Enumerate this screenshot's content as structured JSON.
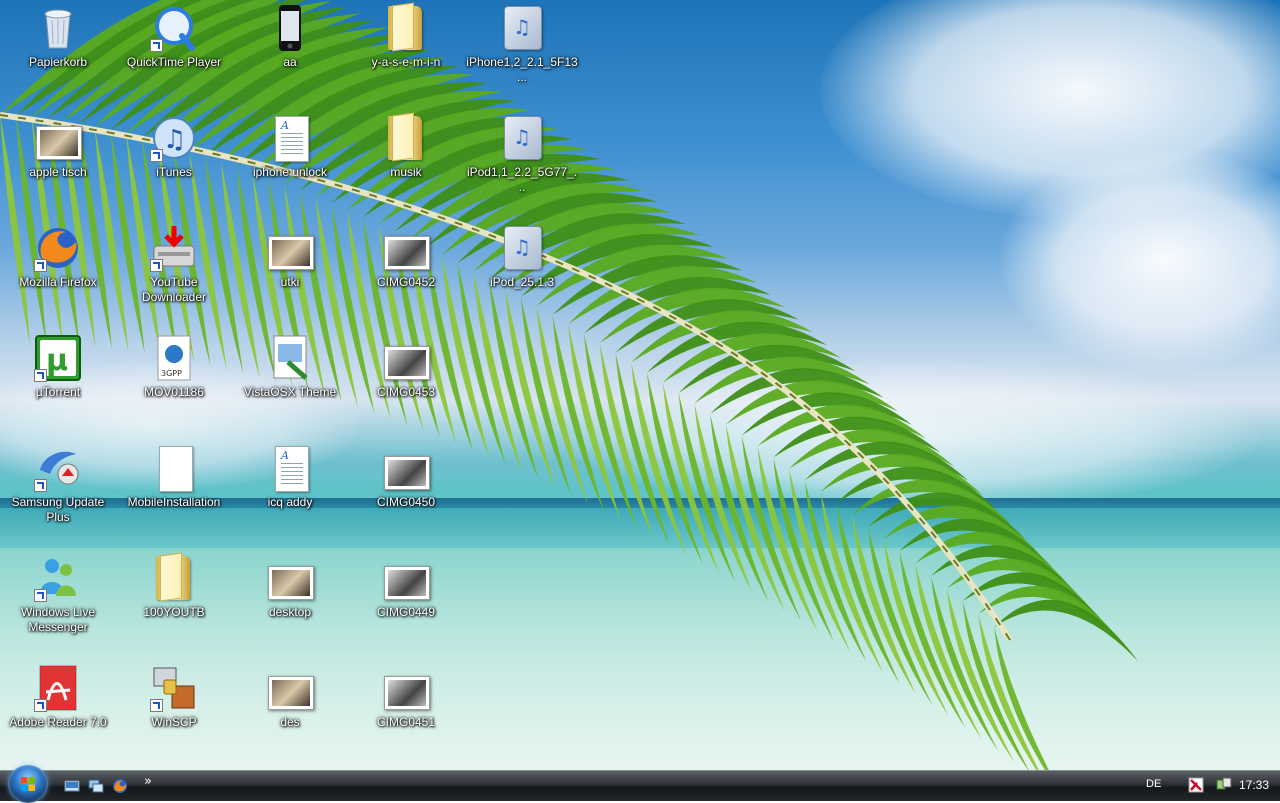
{
  "desktop": {
    "icons": [
      {
        "label": "Papierkorb",
        "icon": "recycle-bin-icon"
      },
      {
        "label": "QuickTime Player",
        "icon": "quicktime-icon"
      },
      {
        "label": "aa",
        "icon": "iphone-icon"
      },
      {
        "label": "y-a-s-e-m-i-n",
        "icon": "folder-icon"
      },
      {
        "label": "iPhone1,2_2.1_5F13...",
        "icon": "ipsw-file-icon"
      },
      {
        "label": "apple tisch",
        "icon": "image-file-icon"
      },
      {
        "label": "iTunes",
        "icon": "itunes-icon"
      },
      {
        "label": "iphone unlock",
        "icon": "text-document-icon"
      },
      {
        "label": "musik",
        "icon": "folder-icon"
      },
      {
        "label": "iPod1,1_2.2_5G77_...",
        "icon": "ipsw-file-icon"
      },
      {
        "label": "Mozilla Firefox",
        "icon": "firefox-icon"
      },
      {
        "label": "YouTube Downloader",
        "icon": "youtube-downloader-icon"
      },
      {
        "label": "utki",
        "icon": "image-file-icon"
      },
      {
        "label": "CIMG0452",
        "icon": "photo-icon"
      },
      {
        "label": "iPod_25.1.3",
        "icon": "ipsw-file-icon"
      },
      {
        "label": "µTorrent",
        "icon": "utorrent-icon"
      },
      {
        "label": "MOV01186",
        "icon": "3gpp-video-icon"
      },
      {
        "label": "VistaOSX Theme",
        "icon": "theme-installer-icon"
      },
      {
        "label": "CIMG0453",
        "icon": "photo-icon"
      },
      {
        "label": "Samsung Update Plus",
        "icon": "samsung-update-icon"
      },
      {
        "label": "MobileInstallation",
        "icon": "blank-file-icon"
      },
      {
        "label": "icq addy",
        "icon": "text-document-icon"
      },
      {
        "label": "CIMG0450",
        "icon": "photo-icon"
      },
      {
        "label": "Windows Live Messenger",
        "icon": "messenger-icon"
      },
      {
        "label": "100YOUTB",
        "icon": "folder-icon"
      },
      {
        "label": "desktop",
        "icon": "image-file-icon"
      },
      {
        "label": "CIMG0449",
        "icon": "photo-icon"
      },
      {
        "label": "Adobe Reader 7.0",
        "icon": "adobe-reader-icon"
      },
      {
        "label": "WinSCP",
        "icon": "winscp-icon"
      },
      {
        "label": "des",
        "icon": "image-file-icon"
      },
      {
        "label": "CIMG0451",
        "icon": "photo-icon"
      }
    ]
  },
  "taskbar": {
    "start_icon": "windows-start-orb-icon",
    "quick_launch": [
      "show-desktop-icon",
      "switch-windows-icon",
      "firefox-icon"
    ],
    "more_label": "»",
    "language": "DE",
    "tray_icons": [
      "antivirus-icon",
      "network-icon"
    ],
    "clock": "17:33"
  }
}
